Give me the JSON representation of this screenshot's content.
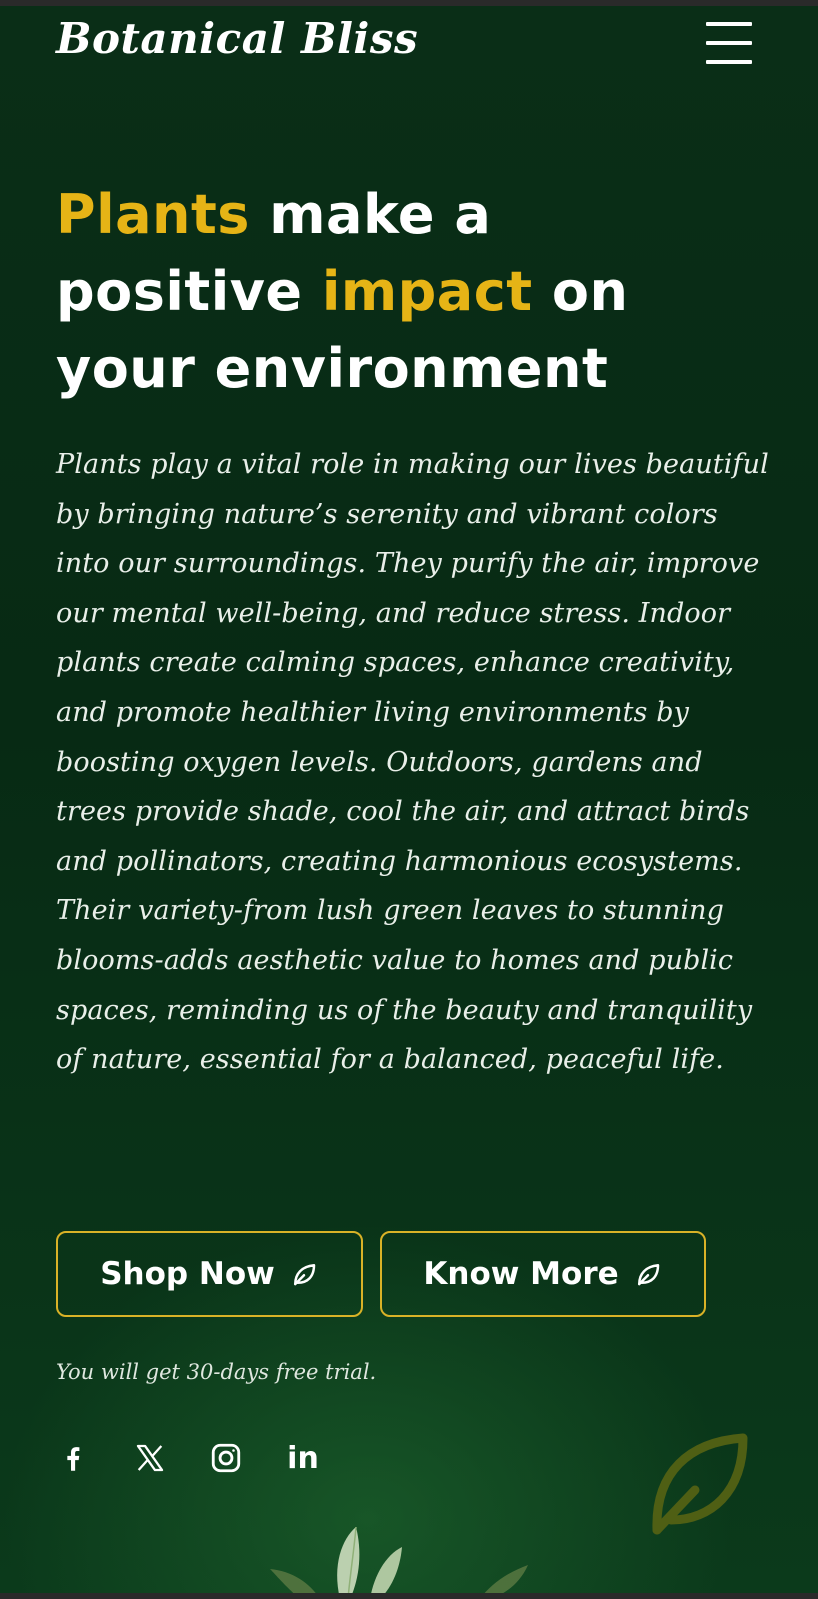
{
  "header": {
    "brand": "Botanical Bliss",
    "menu_icon": "hamburger-menu-icon"
  },
  "hero": {
    "headline_parts": [
      {
        "text": "Plants",
        "highlight": true
      },
      {
        "text": " make a ",
        "highlight": false
      },
      {
        "text": "positive ",
        "highlight": false
      },
      {
        "text": "impact",
        "highlight": true
      },
      {
        "text": " on ",
        "highlight": false
      },
      {
        "text": "your environment",
        "highlight": false
      }
    ],
    "description": "Plants play a vital role in making our lives beautiful by bringing nature’s serenity and vibrant colors into our surroundings. They purify the air, improve our mental well-being, and reduce stress. Indoor plants create calming spaces, enhance creativity, and promote healthier living environments by boosting oxygen levels. Outdoors, gardens and trees provide shade, cool the air, and attract birds and pollinators, creating harmonious ecosystems. Their variety-from lush green leaves to stunning blooms-adds aesthetic value to homes and public spaces, reminding us of the beauty and tranquility of nature, essential for a balanced, peaceful life.",
    "buttons": {
      "shop_now": "Shop Now",
      "know_more": "Know More",
      "button_icon": "leaf-icon"
    },
    "trial_note": "You will get 30-days free trial."
  },
  "social": {
    "facebook_icon": "facebook-icon",
    "x_icon": "x-icon",
    "instagram_icon": "instagram-icon",
    "linkedin_label": "in"
  },
  "colors": {
    "accent": "#e6b416",
    "background": "#0a2e17",
    "button_border": "#d9b227",
    "text": "#ffffff"
  }
}
